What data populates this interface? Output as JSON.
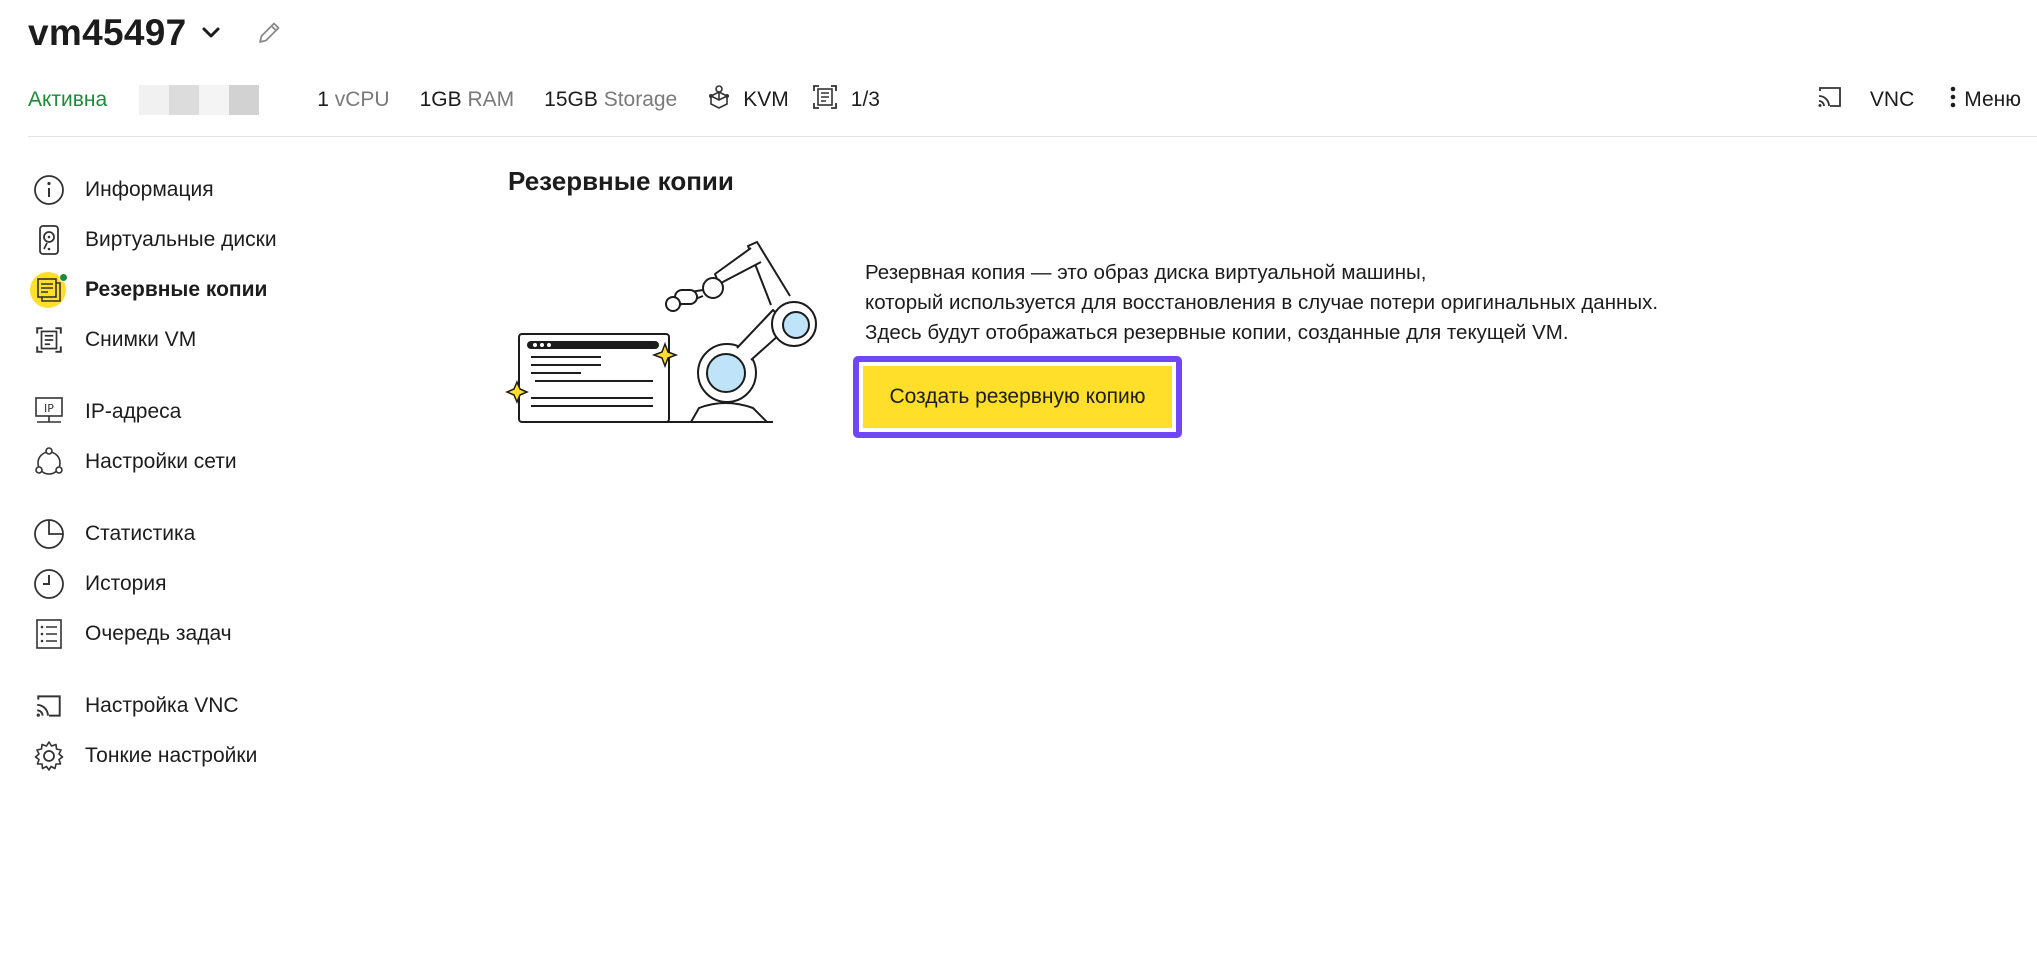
{
  "header": {
    "vm_name": "vm45497",
    "status": "Активна",
    "specs": {
      "cpu_value": "1",
      "cpu_unit": "vCPU",
      "ram_value": "1GB",
      "ram_unit": "RAM",
      "storage_value": "15GB",
      "storage_unit": "Storage",
      "hypervisor": "KVM",
      "snapshots": "1/3"
    },
    "vnc_label": "VNC",
    "menu_label": "Меню"
  },
  "sidebar": {
    "items": [
      {
        "label": "Информация",
        "icon": "info-icon"
      },
      {
        "label": "Виртуальные диски",
        "icon": "disk-icon"
      },
      {
        "label": "Резервные копии",
        "icon": "backup-icon",
        "active": true
      },
      {
        "label": "Снимки VM",
        "icon": "snapshot-icon"
      },
      {
        "label": "IP-адреса",
        "icon": "ip-icon"
      },
      {
        "label": "Настройки сети",
        "icon": "network-icon"
      },
      {
        "label": "Статистика",
        "icon": "pie-chart-icon"
      },
      {
        "label": "История",
        "icon": "clock-icon"
      },
      {
        "label": "Очередь задач",
        "icon": "task-list-icon"
      },
      {
        "label": "Настройка VNC",
        "icon": "vnc-icon"
      },
      {
        "label": "Тонкие настройки",
        "icon": "gear-icon"
      }
    ]
  },
  "main": {
    "title": "Резервные копии",
    "description": [
      "Резервная копия — это образ диска виртуальной машины,",
      "который используется для восстановления в случае потери оригинальных данных.",
      "Здесь будут отображаться резервные копии, созданные для текущей VM."
    ],
    "create_button": "Создать резервную копию"
  },
  "colors": {
    "status_green": "#1e8a3a",
    "accent_yellow": "#ffdf29",
    "highlight_purple": "#6f47f5"
  }
}
